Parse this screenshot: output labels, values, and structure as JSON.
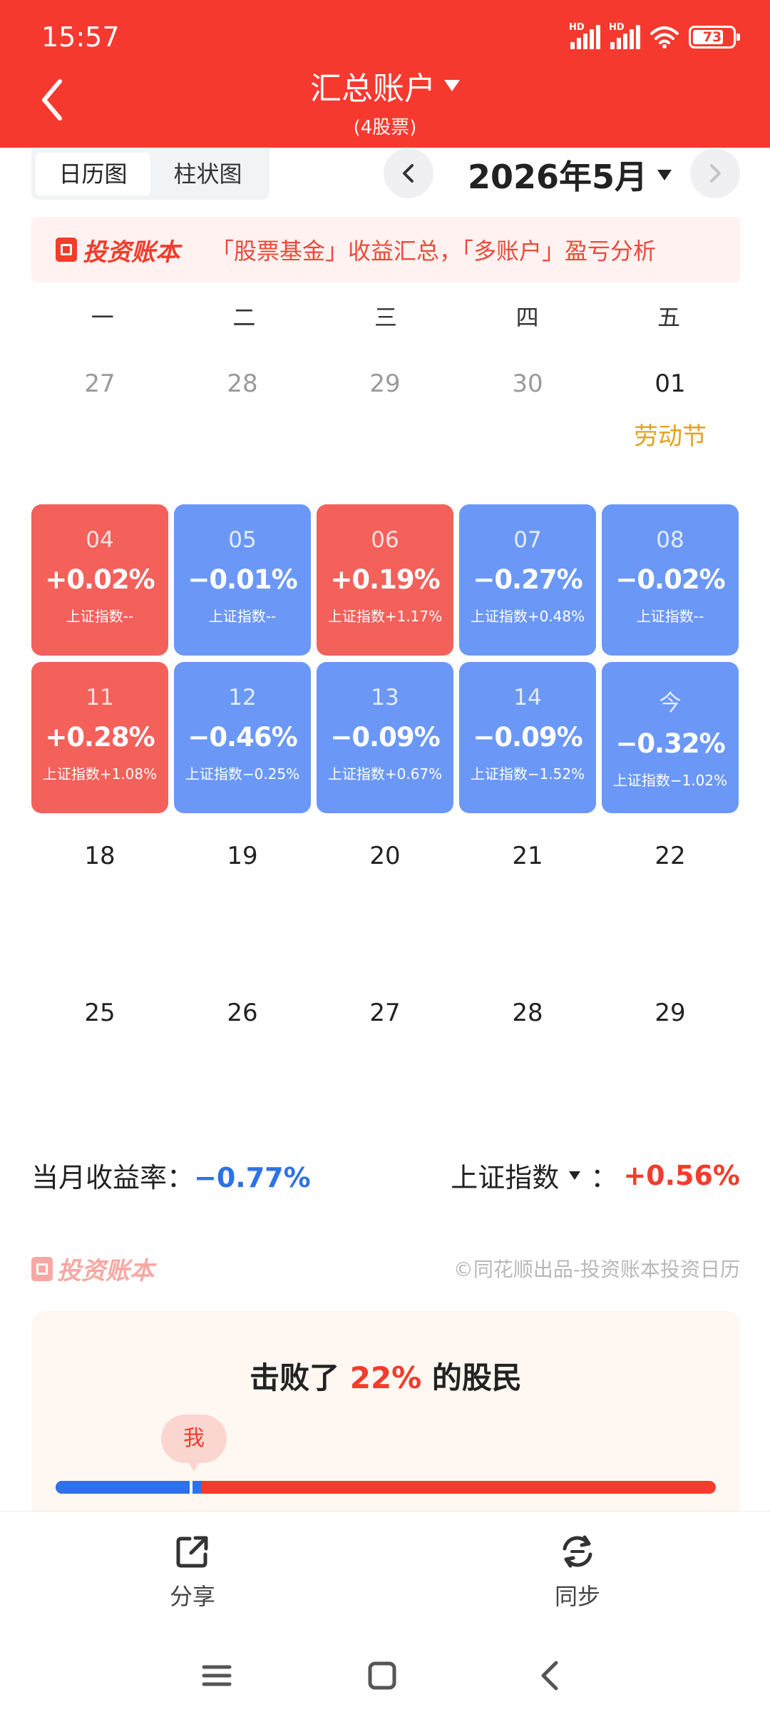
{
  "status_bar": {
    "time": "15:57",
    "battery": "73"
  },
  "header": {
    "title": "汇总账户",
    "subtitle": "(4股票)"
  },
  "view_tabs": [
    {
      "label": "日历图",
      "active": true
    },
    {
      "label": "柱状图",
      "active": false
    }
  ],
  "month": "2026年5月",
  "banner": {
    "brand": "投资账本",
    "text": "「股票基金」收益汇总，「多账户」盈亏分析"
  },
  "weekdays": [
    "一",
    "二",
    "三",
    "四",
    "五"
  ],
  "calendar": {
    "row1": [
      {
        "day": "27",
        "muted": true
      },
      {
        "day": "28",
        "muted": true
      },
      {
        "day": "29",
        "muted": true
      },
      {
        "day": "30",
        "muted": true
      },
      {
        "day": "01",
        "holiday": "劳动节"
      }
    ],
    "row2": [
      {
        "day": "04",
        "pct": "+0.02%",
        "index": "上证指数--",
        "trend": "up"
      },
      {
        "day": "05",
        "pct": "−0.01%",
        "index": "上证指数--",
        "trend": "down"
      },
      {
        "day": "06",
        "pct": "+0.19%",
        "index": "上证指数+1.17%",
        "trend": "up"
      },
      {
        "day": "07",
        "pct": "−0.27%",
        "index": "上证指数+0.48%",
        "trend": "down"
      },
      {
        "day": "08",
        "pct": "−0.02%",
        "index": "上证指数--",
        "trend": "down"
      }
    ],
    "row3": [
      {
        "day": "11",
        "pct": "+0.28%",
        "index": "上证指数+1.08%",
        "trend": "up"
      },
      {
        "day": "12",
        "pct": "−0.46%",
        "index": "上证指数−0.25%",
        "trend": "down"
      },
      {
        "day": "13",
        "pct": "−0.09%",
        "index": "上证指数+0.67%",
        "trend": "down"
      },
      {
        "day": "14",
        "pct": "−0.09%",
        "index": "上证指数−1.52%",
        "trend": "down"
      },
      {
        "day": "今",
        "pct": "−0.32%",
        "index": "上证指数−1.02%",
        "trend": "down"
      }
    ],
    "row4": [
      "18",
      "19",
      "20",
      "21",
      "22"
    ],
    "row5": [
      "25",
      "26",
      "27",
      "28",
      "29"
    ]
  },
  "summary": {
    "monthly_label": "当月收益率：",
    "monthly_value": "−0.77%",
    "index_label": "上证指数",
    "index_colon": "：",
    "index_value": "+0.56%"
  },
  "footer_brand": "投资账本",
  "copyright": "©同花顺出品-投资账本投资日历",
  "beat": {
    "prefix": "击败了 ",
    "percent": "22%",
    "suffix": " 的股民",
    "me_label": "我",
    "fraction": 0.22
  },
  "actions": {
    "share": "分享",
    "sync": "同步"
  },
  "colors": {
    "accent": "#f6392f",
    "up_tile": "#f4605a",
    "down_tile": "#6b98f7",
    "holiday": "#e3a31d"
  }
}
